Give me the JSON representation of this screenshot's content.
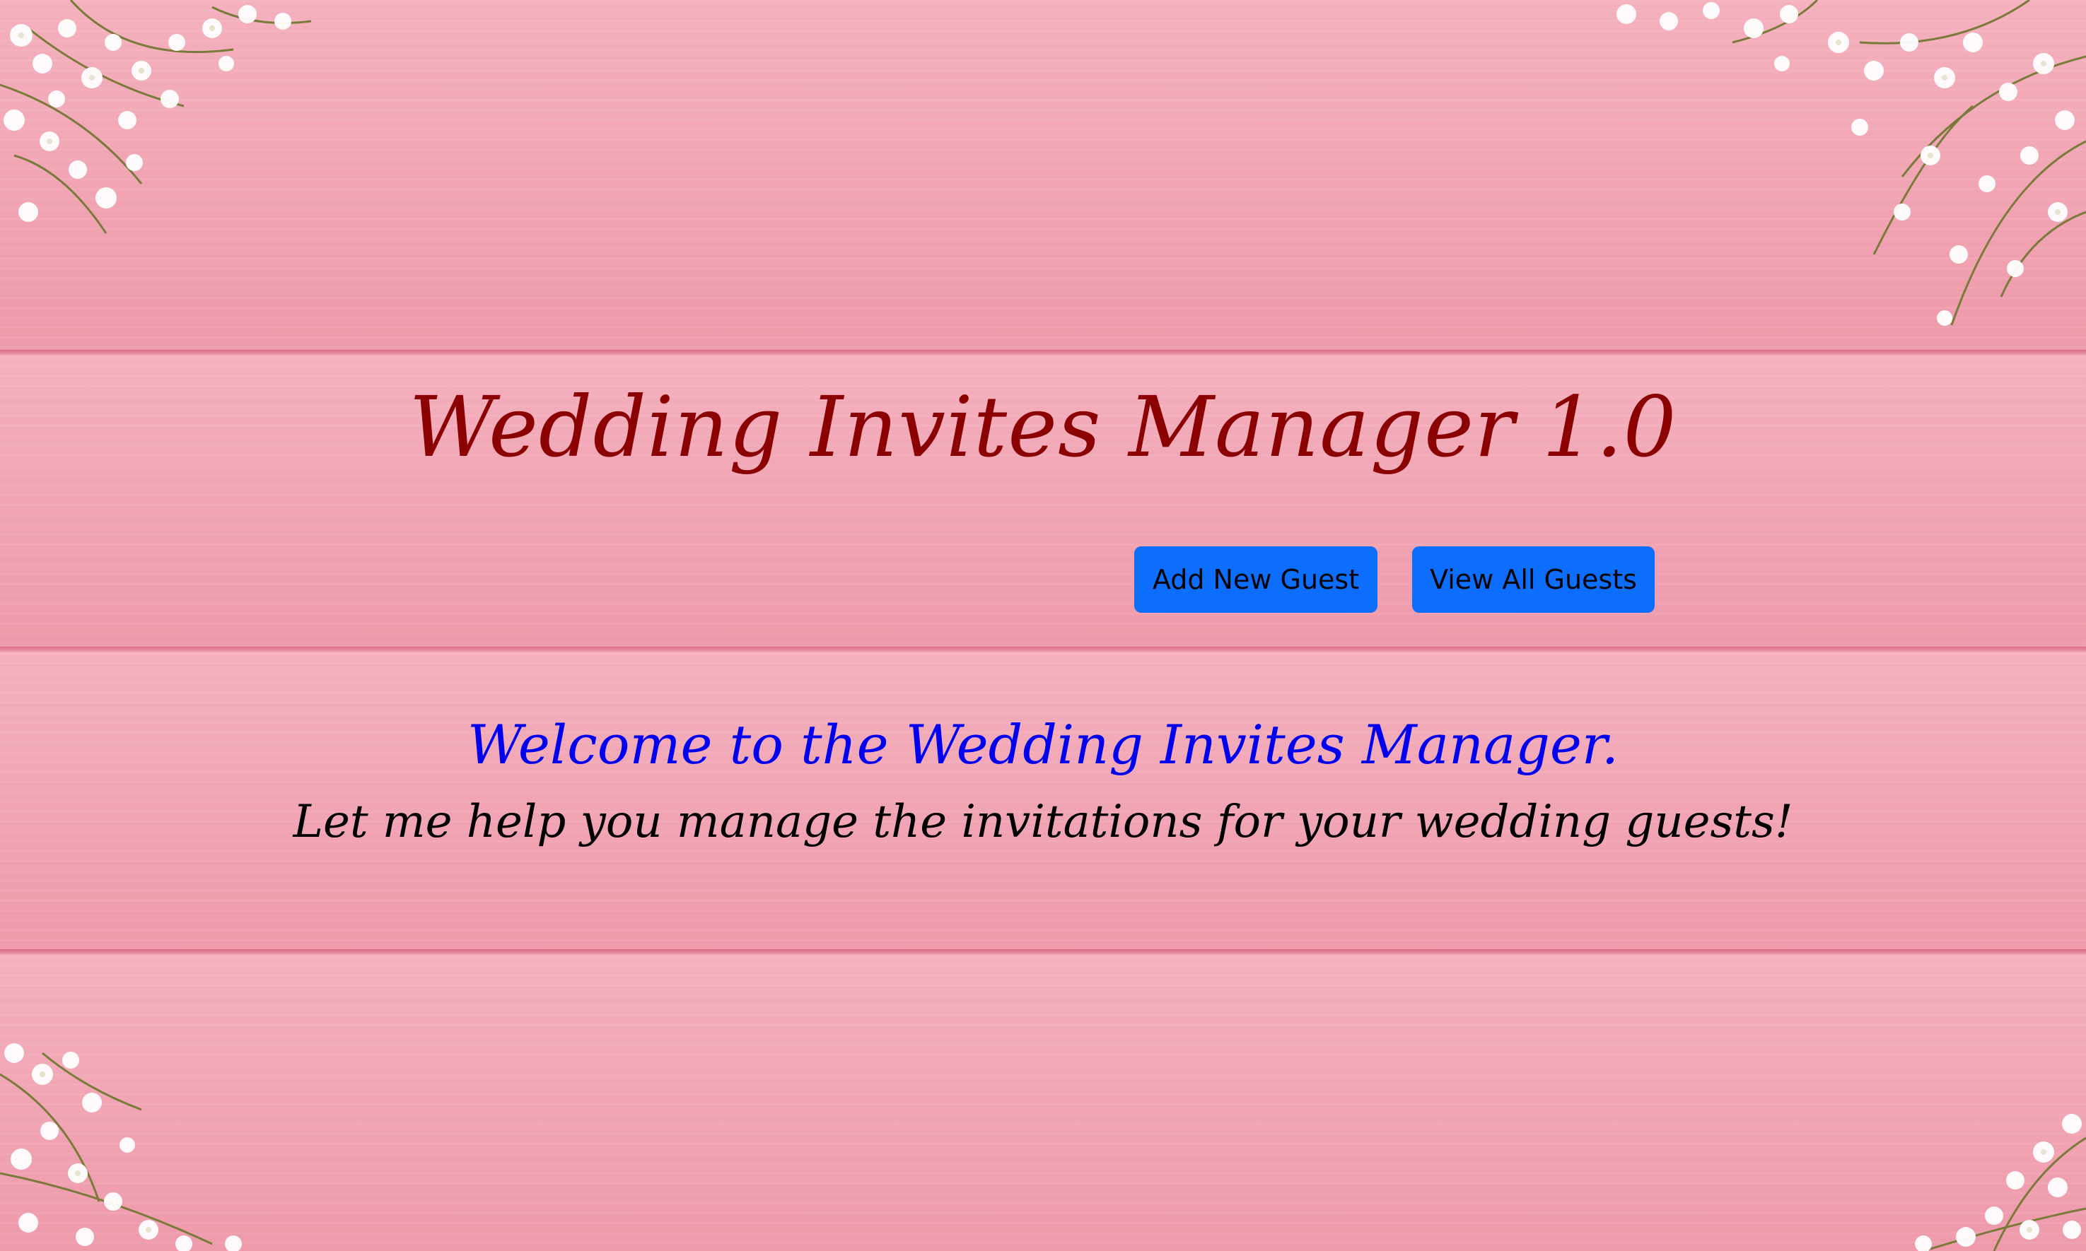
{
  "app": {
    "title": "Wedding Invites Manager 1.0"
  },
  "nav": {
    "add_label": "Add New Guest",
    "view_label": "View All Guests"
  },
  "intro": {
    "welcome": "Welcome to the Wedding Invites Manager.",
    "subtitle": "Let me help you manage the invitations for your wedding guests!"
  },
  "colors": {
    "background": "#f0a5b3",
    "title": "#8b0000",
    "welcome": "#0000ee",
    "subtitle": "#000000",
    "button": "#0d6efd",
    "button_text": "#000000"
  },
  "decor": {
    "background_icon": "pink-wood-planks",
    "corner_icon": "babys-breath-flowers"
  }
}
